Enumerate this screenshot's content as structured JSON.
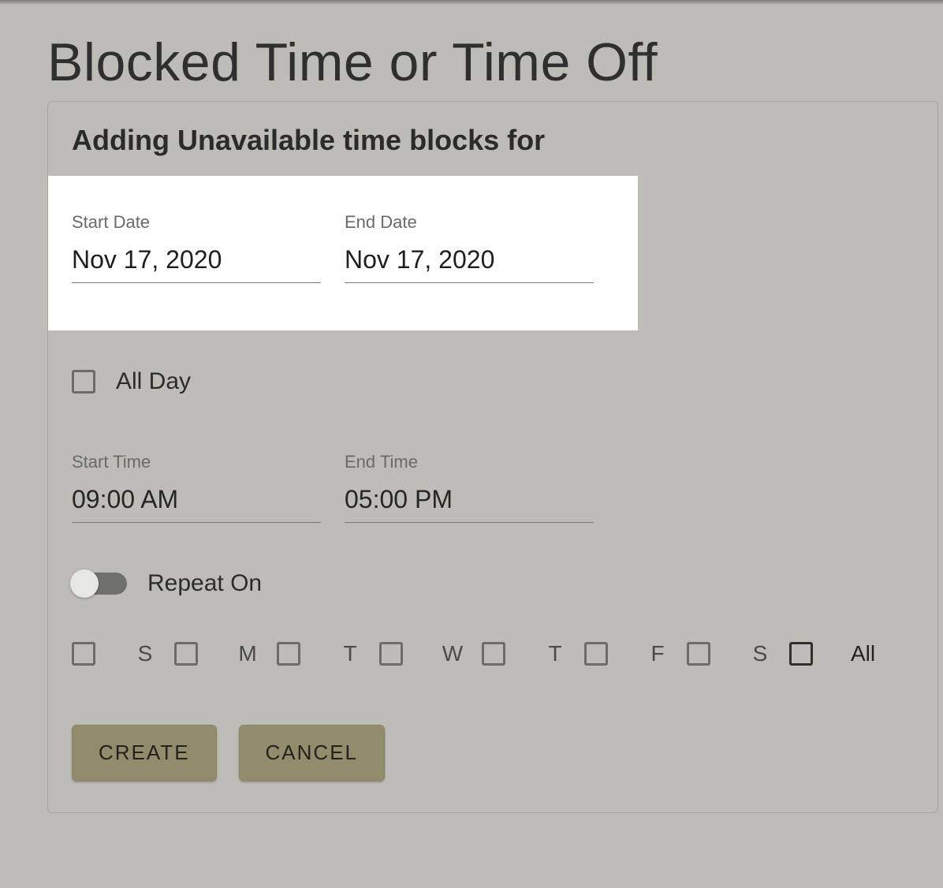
{
  "page": {
    "title": "Blocked Time or Time Off"
  },
  "card": {
    "subtitle": "Adding Unavailable time blocks for"
  },
  "dates": {
    "start_label": "Start Date",
    "start_value": "Nov 17, 2020",
    "end_label": "End Date",
    "end_value": "Nov 17, 2020"
  },
  "allday": {
    "label": "All Day",
    "checked": false
  },
  "times": {
    "start_label": "Start Time",
    "start_value": "09:00 AM",
    "end_label": "End Time",
    "end_value": "05:00 PM"
  },
  "repeat": {
    "label": "Repeat On",
    "on": false,
    "days": [
      "S",
      "M",
      "T",
      "W",
      "T",
      "F",
      "S"
    ],
    "all_label": "All"
  },
  "buttons": {
    "create": "CREATE",
    "cancel": "CANCEL"
  }
}
